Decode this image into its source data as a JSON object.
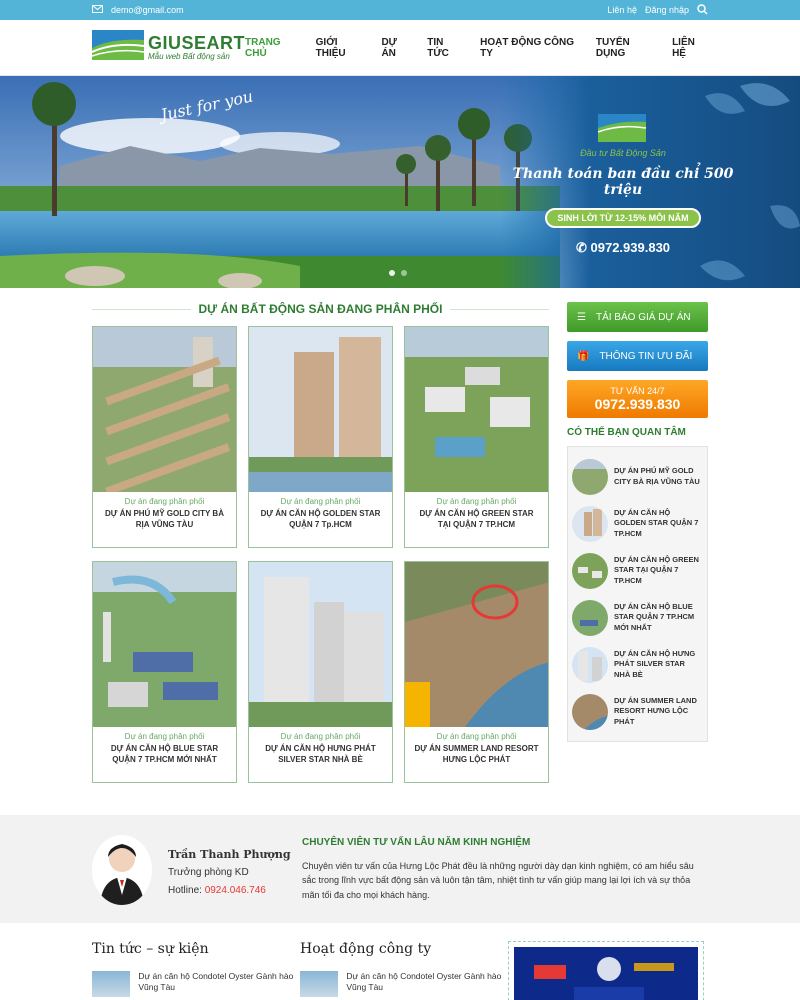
{
  "topbar": {
    "email": "demo@gmail.com",
    "register": "Liên hệ",
    "login": "Đăng nhập"
  },
  "logo": {
    "name": "GIUSEART",
    "tagline": "Mẫu web Bất động sản"
  },
  "nav": [
    "TRANG CHỦ",
    "GIỚI THIỆU",
    "DỰ ÁN",
    "TIN TỨC",
    "HOẠT ĐỘNG CÔNG TY",
    "TUYỂN DỤNG",
    "LIÊN HỆ"
  ],
  "hero": {
    "script": "Just for you",
    "brand": "Đầu tư Bất Động Sản",
    "payment": "Thanh toán ban đầu chỉ 500 triệu",
    "profit": "SINH LỜI TỪ 12-15% MỖI NĂM",
    "phone": "0972.939.830"
  },
  "projects": {
    "title": "DỰ ÁN BẤT ĐỘNG SẢN ĐANG PHÂN PHỐI",
    "items": [
      {
        "status": "Dự án đang phân phối",
        "title": "DỰ ÁN PHÚ MỸ GOLD CITY BÀ RỊA VŨNG TÀU"
      },
      {
        "status": "Dự án đang phân phối",
        "title": "DỰ ÁN CĂN HỘ GOLDEN STAR QUẬN 7 Tp.HCM"
      },
      {
        "status": "Dự án đang phân phối",
        "title": "DỰ ÁN CĂN HỘ GREEN STAR TẠI QUẬN 7 TP.HCM"
      },
      {
        "status": "Dự án đang phân phối",
        "title": "DỰ ÁN CĂN HỘ BLUE STAR QUẬN 7 TP.HCM MỚI NHẤT"
      },
      {
        "status": "Dự án đang phân phối",
        "title": "DỰ ÁN CĂN HỘ HƯNG PHÁT SILVER STAR NHÀ BÈ"
      },
      {
        "status": "Dự án đang phân phối",
        "title": "DỰ ÁN SUMMER LAND RESORT HƯNG LỘC PHÁT"
      }
    ]
  },
  "sidebar": {
    "quote": "TẢI BÁO GIÁ DỰ ÁN",
    "offers": "THÔNG TIN ƯU ĐÃI",
    "consult_label": "TƯ VẤN 24/7",
    "consult_phone": "0972.939.830",
    "related_title": "CÓ THỂ BẠN QUAN TÂM",
    "related": [
      "DỰ ÁN PHÚ MỸ GOLD CITY BÀ RỊA VŨNG TÀU",
      "DỰ ÁN CĂN HỘ GOLDEN STAR QUẬN 7 TP.HCM",
      "DỰ ÁN CĂN HỘ GREEN STAR TẠI QUẬN 7 TP.HCM",
      "DỰ ÁN CĂN HỘ BLUE STAR QUẬN 7 TP.HCM MỚI NHẤT",
      "DỰ ÁN CĂN HỘ HƯNG PHÁT SILVER STAR NHÀ BÈ",
      "DỰ ÁN SUMMER LAND RESORT HƯNG LỘC PHÁT"
    ]
  },
  "consultant": {
    "name": "Trần Thanh Phượng",
    "role": "Trưởng phòng KD",
    "hotline_label": "Hotline:",
    "hotline": "0924.046.746",
    "title": "CHUYÊN VIÊN TƯ VẤN LÂU NĂM KINH NGHIỆM",
    "desc": "Chuyên viên tư vấn của Hưng Lộc Phát đều là những người dày dạn kinh nghiệm, có am hiểu sâu sắc trong lĩnh vực bất động sản và luôn tận tâm, nhiệt tình tư vấn giúp mang lại lợi ích và sự thỏa mãn tối đa cho mọi khách hàng."
  },
  "news": {
    "col1_title": "Tin tức – sự kiện",
    "col2_title": "Hoạt động công ty",
    "item": "Dự án căn hộ Condotel Oyster Gành hào Vũng Tàu"
  },
  "colors": {
    "green": "#2e7d32",
    "topbar": "#54b4d8",
    "orange": "#ef7a00",
    "blue": "#1779c0"
  }
}
